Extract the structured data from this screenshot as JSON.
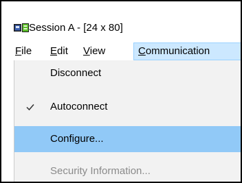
{
  "window": {
    "title": "Session A - [24 x 80]"
  },
  "menubar": {
    "items": [
      {
        "mnemonic": "F",
        "rest": "ile"
      },
      {
        "mnemonic": "E",
        "rest": "dit"
      },
      {
        "mnemonic": "V",
        "rest": "iew"
      },
      {
        "mnemonic": "C",
        "rest": "ommunication"
      }
    ],
    "active_index": 3
  },
  "dropdown": {
    "items": [
      {
        "label": "Disconnect",
        "checked": false,
        "enabled": true
      },
      {
        "label": "Autoconnect",
        "checked": true,
        "enabled": true
      },
      {
        "label": "Configure...",
        "checked": false,
        "enabled": true,
        "highlighted": true
      },
      {
        "label": "Security Information...",
        "checked": false,
        "enabled": false
      }
    ]
  },
  "colors": {
    "menu_active_bg": "#cce8ff",
    "dropdown_bg": "#f2f2f2",
    "highlight_bg": "#91c9f7",
    "disabled_text": "#8a8a8a"
  },
  "icons": {
    "app": "emulator-app-icon",
    "check": "checkmark-icon"
  }
}
